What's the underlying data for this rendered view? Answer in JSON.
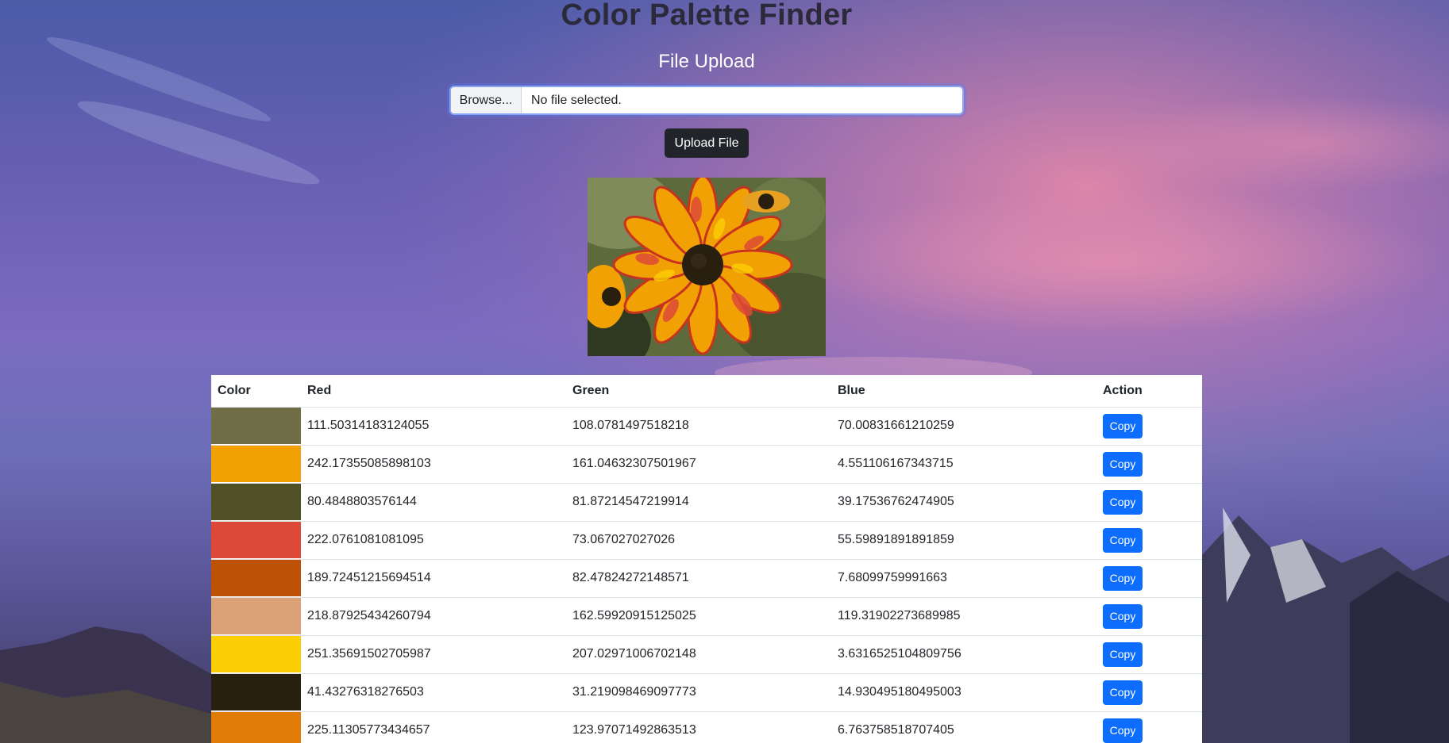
{
  "page": {
    "title": "Color Palette Finder",
    "subtitle": "File Upload"
  },
  "upload": {
    "browse_label": "Browse...",
    "file_status": "No file selected.",
    "upload_button_label": "Upload File"
  },
  "preview": {
    "icon": "flower-image"
  },
  "table": {
    "headers": {
      "color": "Color",
      "red": "Red",
      "green": "Green",
      "blue": "Blue",
      "action": "Action"
    },
    "rows": [
      {
        "swatch": "#6f6e46",
        "red": "111.50314183124055",
        "green": "108.0781497518218",
        "blue": "70.00831661210259",
        "action": "Copy"
      },
      {
        "swatch": "#f2a104",
        "red": "242.17355085898103",
        "green": "161.04632307501967",
        "blue": "4.551106167343715",
        "action": "Copy"
      },
      {
        "swatch": "#505127",
        "red": "80.4848803576144",
        "green": "81.87214547219914",
        "blue": "39.17536762474905",
        "action": "Copy"
      },
      {
        "swatch": "#de4937",
        "red": "222.0761081081095",
        "green": "73.067027027026",
        "blue": "55.59891891891859",
        "action": "Copy"
      },
      {
        "swatch": "#bd5207",
        "red": "189.72451215694514",
        "green": "82.47824272148571",
        "blue": "7.68099759991663",
        "action": "Copy"
      },
      {
        "swatch": "#dba277",
        "red": "218.87925434260794",
        "green": "162.59920915125025",
        "blue": "119.31902273689985",
        "action": "Copy"
      },
      {
        "swatch": "#fbcf04",
        "red": "251.35691502705987",
        "green": "207.02971006702148",
        "blue": "3.6316525104809756",
        "action": "Copy"
      },
      {
        "swatch": "#291f0f",
        "red": "41.43276318276503",
        "green": "31.219098469097773",
        "blue": "14.930495180495003",
        "action": "Copy"
      },
      {
        "swatch": "#e17c07",
        "red": "225.11305773434657",
        "green": "123.97071492863513",
        "blue": "6.763758518707405",
        "action": "Copy"
      }
    ]
  }
}
